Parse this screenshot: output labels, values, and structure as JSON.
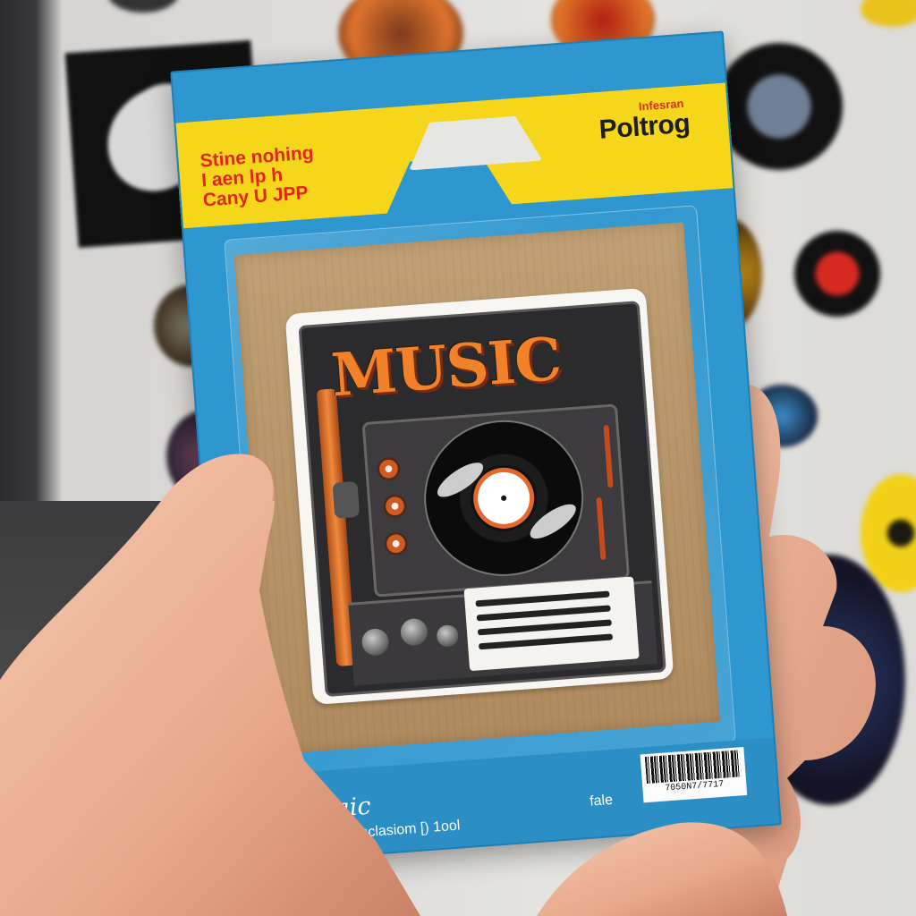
{
  "package": {
    "header_left": [
      "Stine nohing",
      "I aen lp h",
      "Cany   U JPP"
    ],
    "brand_small": "Infesran",
    "brand": "Poltrog",
    "sticker_title": "MUSIC",
    "bottom_title": "Lias Saic",
    "bottom_sub": "Sul 8sone  p  Ubnclasiom  [)  1ool",
    "bottom_right": "fale",
    "barcode_number": "7050N7/7717",
    "colors": {
      "card_blue": "#2f97cf",
      "header_yellow": "#f6d61a",
      "header_red_text": "#e2271a",
      "sticker_orange": "#f2822a",
      "cardboard": "#b9976c"
    }
  }
}
